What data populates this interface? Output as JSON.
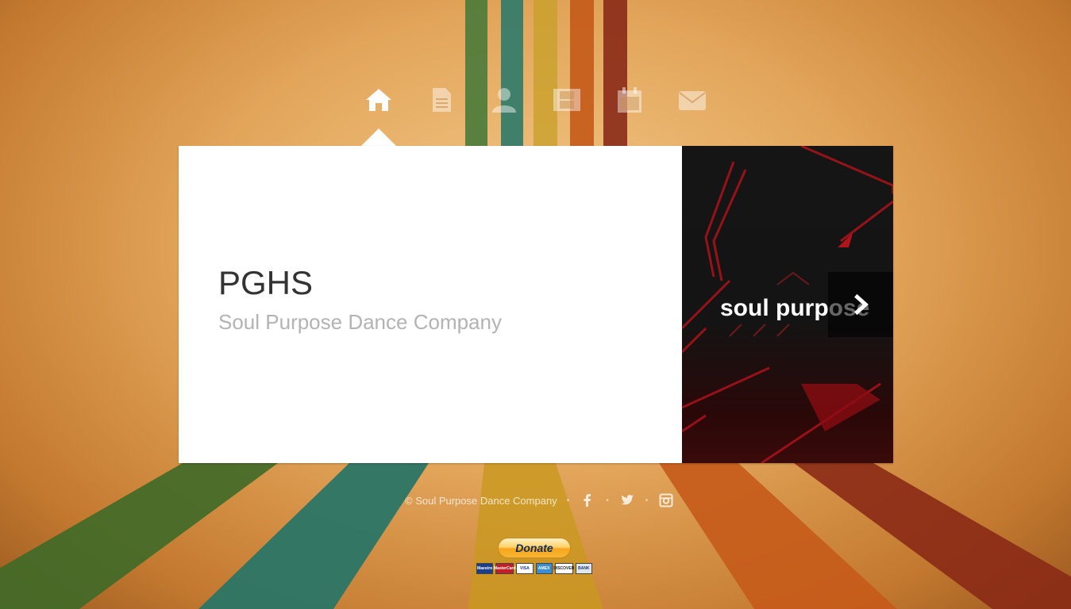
{
  "nav": {
    "items": [
      {
        "name": "home",
        "active": true
      },
      {
        "name": "document"
      },
      {
        "name": "profile"
      },
      {
        "name": "film"
      },
      {
        "name": "calendar"
      },
      {
        "name": "mail"
      }
    ]
  },
  "card": {
    "title": "PGHS",
    "subtitle": "Soul Purpose Dance Company",
    "image_text": "soul purpose",
    "next_icon": "chevron-right-icon"
  },
  "footer": {
    "copyright": "© Soul Purpose Dance Company",
    "separator": "•",
    "social": [
      "facebook-icon",
      "twitter-icon",
      "instagram-icon"
    ]
  },
  "donate": {
    "label": "Donate",
    "cards": [
      "Maestro",
      "MasterCard",
      "VISA",
      "AMEX",
      "DISCOVER",
      "BANK"
    ]
  },
  "colors": {
    "accent_red": "#b00d10",
    "card_bg": "#ffffff",
    "title": "#333333",
    "subtitle": "#b3b3b3"
  }
}
